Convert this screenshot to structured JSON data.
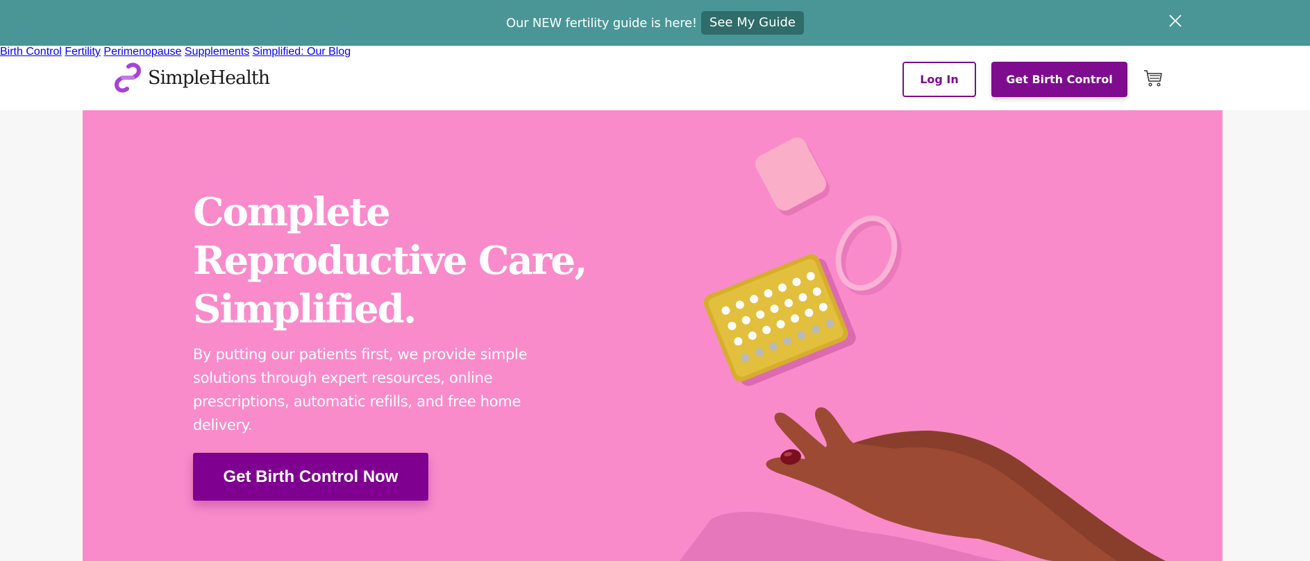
{
  "announcement": {
    "text": "Our NEW fertility guide is here!",
    "button_label": "See My Guide",
    "close_icon": "close-icon"
  },
  "header": {
    "logo_text": "SimpleHealth",
    "nav": [
      {
        "label": "Birth Control"
      },
      {
        "label": "Fertility"
      },
      {
        "label": "Perimenopause"
      },
      {
        "label": "Supplements"
      },
      {
        "label": "Simplified: Our Blog"
      }
    ],
    "login_label": "Log In",
    "cta_label": "Get Birth Control",
    "cart_icon": "cart-icon"
  },
  "hero": {
    "title_line1": "Complete",
    "title_line2": "Reproductive Care,",
    "title_line3": "Simplified.",
    "subtitle": "By putting our patients first, we provide simple solutions through expert resources, online prescriptions, automatic refills, and free home delivery.",
    "cta_label": "Get Birth Control Now",
    "illustration": "hand-with-contraceptives-image"
  },
  "colors": {
    "announcement_bg": "#4a9696",
    "hero_bg": "#f98bcb",
    "brand_purple": "#7f0b8f"
  }
}
